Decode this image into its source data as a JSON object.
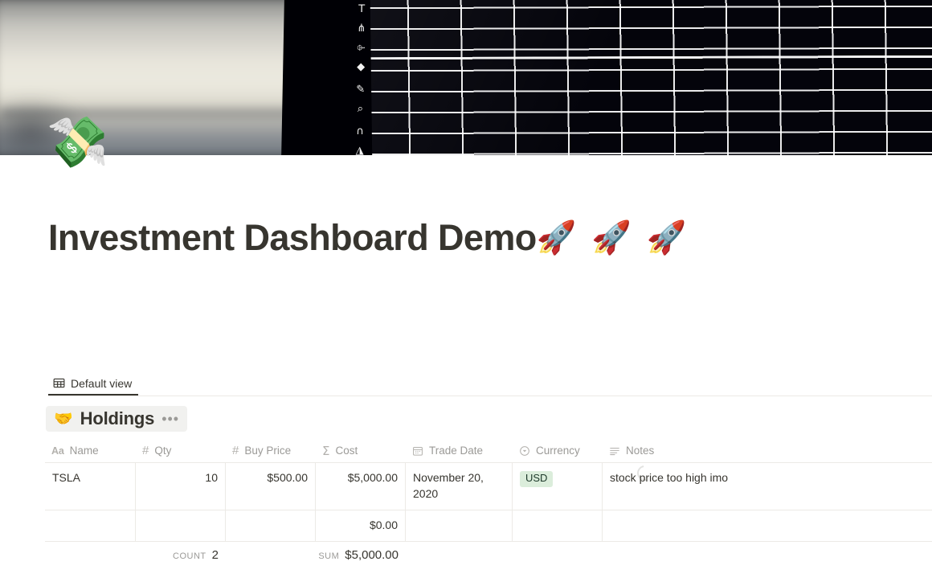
{
  "cover": {
    "name": "cover-photo",
    "description": "blurred photo of a laptop showing a dark spreadsheet grid",
    "toolbar_glyphs": [
      "T",
      "⋔",
      "⌱",
      "◆",
      "✎",
      "⌕",
      "∩",
      "◮"
    ]
  },
  "page": {
    "emoji": "💸",
    "title_text": "Investment Dashboard Demo",
    "title_emojis": "🚀 🚀 🚀",
    "loading_label": "loading"
  },
  "view_tabs": [
    {
      "label": "Default view",
      "icon": "table-icon",
      "active": true
    }
  ],
  "database": {
    "emoji": "🤝",
    "name": "Holdings",
    "menu_label": "•••"
  },
  "table": {
    "columns": [
      {
        "key": "name",
        "label": "Name",
        "icon": "Aa",
        "icon_name": "title-icon",
        "align": "left"
      },
      {
        "key": "qty",
        "label": "Qty",
        "icon": "#",
        "icon_name": "number-icon",
        "align": "right"
      },
      {
        "key": "buyprice",
        "label": "Buy Price",
        "icon": "#",
        "icon_name": "number-icon",
        "align": "right"
      },
      {
        "key": "cost",
        "label": "Cost",
        "icon": "Σ",
        "icon_name": "formula-icon",
        "align": "right"
      },
      {
        "key": "date",
        "label": "Trade Date",
        "icon": "cal",
        "icon_name": "calendar-icon",
        "align": "left"
      },
      {
        "key": "currency",
        "label": "Currency",
        "icon": "sel",
        "icon_name": "select-icon",
        "align": "left"
      },
      {
        "key": "notes",
        "label": "Notes",
        "icon": "txt",
        "icon_name": "text-icon",
        "align": "left"
      }
    ],
    "rows": [
      {
        "name": "TSLA",
        "qty": "10",
        "buyprice": "$500.00",
        "cost": "$5,000.00",
        "date": "November 20, 2020",
        "currency": "USD",
        "notes": "stock price too high imo"
      },
      {
        "name": "",
        "qty": "",
        "buyprice": "",
        "cost": "$0.00",
        "date": "",
        "currency": "",
        "notes": ""
      }
    ],
    "aggregates": {
      "count_label": "COUNT",
      "count_value": "2",
      "sum_label": "SUM",
      "sum_value": "$5,000.00"
    }
  },
  "colors": {
    "text": "#37352f",
    "muted": "#9b9a97",
    "border": "#eceae6",
    "tag_usd_bg": "#dbeddb",
    "tag_usd_fg": "#1c3829",
    "db_title_bg": "#f1f1ef"
  }
}
